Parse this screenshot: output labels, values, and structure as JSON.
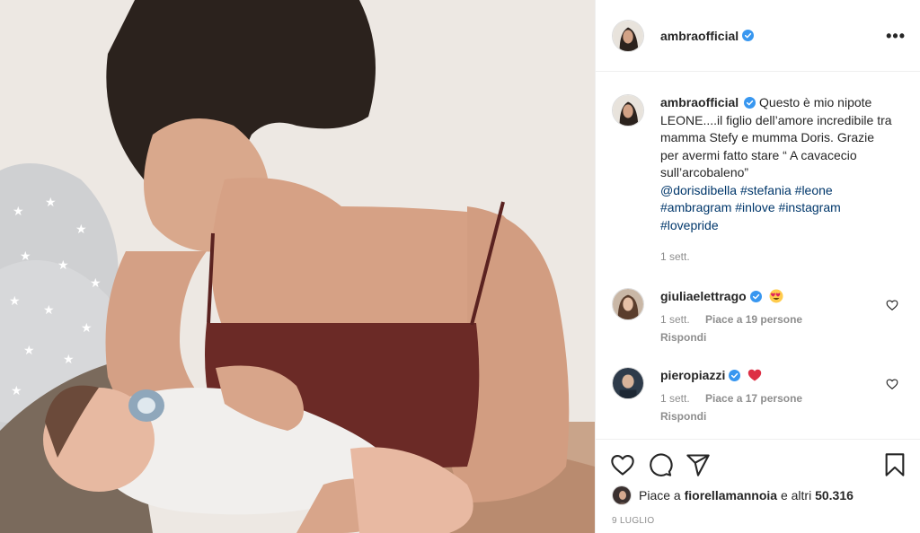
{
  "post": {
    "username": "ambraofficial",
    "more_label": "•••"
  },
  "caption": {
    "username": "ambraofficial",
    "text": "Questo è mio nipote LEONE....il figlio dell’amore incredibile tra mamma Stefy e mumma Doris. Grazie per avermi fatto stare “ A cavacecio sull’arcobaleno”",
    "tags": [
      "@dorisdibella",
      "#stefania",
      "#leone",
      "#ambragram",
      "#inlove",
      "#instagram",
      "#lovepride"
    ],
    "time": "1 sett."
  },
  "comments": [
    {
      "username": "giuliaelettrago",
      "emoji": "heart-eyes-emoji",
      "time": "1 sett.",
      "likes": "Piace a 19 persone",
      "reply": "Rispondi"
    },
    {
      "username": "pieropiazzi",
      "emoji": "red-heart-emoji",
      "time": "1 sett.",
      "likes": "Piace a 17 persone",
      "reply": "Rispondi"
    }
  ],
  "likes": {
    "prefix": "Piace a",
    "user": "fiorellamannoia",
    "suffix": "e altri",
    "count": "50.316"
  },
  "date": "9 LUGLIO",
  "icons": {
    "like": "heart-outline-icon",
    "comment": "comment-bubble-icon",
    "share": "paper-plane-icon",
    "save": "bookmark-icon",
    "verified": "verified-badge-icon"
  },
  "colors": {
    "verified": "#3897f0",
    "link": "#00376b",
    "muted": "#8e8e8e",
    "heart": "#ed4956"
  }
}
